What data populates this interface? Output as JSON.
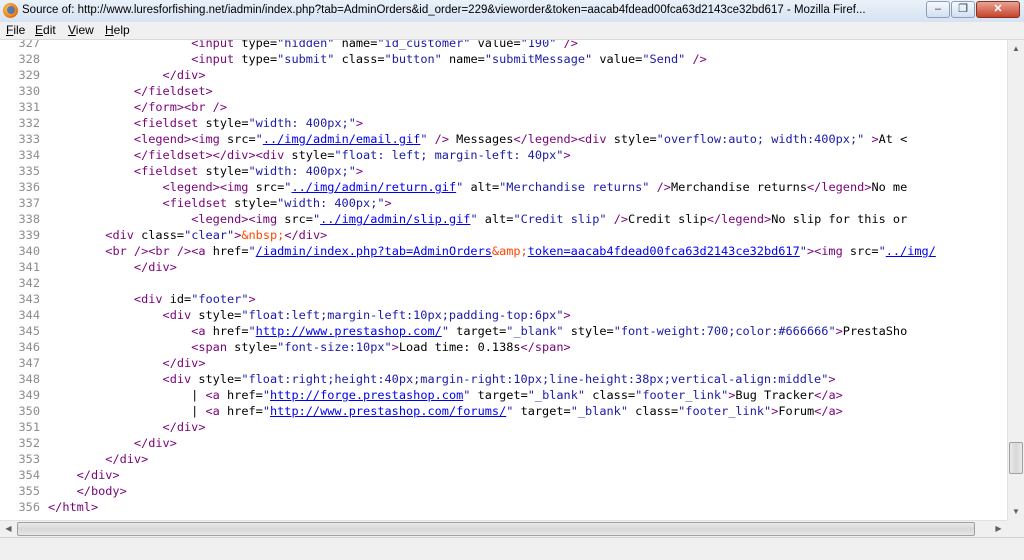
{
  "window": {
    "title": "Source of: http://www.luresforfishing.net/iadmin/index.php?tab=AdminOrders&id_order=229&vieworder&token=aacab4fdead00fca63d2143ce32bd617 - Mozilla Firef...",
    "minimize_glyph": "–",
    "maximize_glyph": "❐",
    "close_glyph": "✕"
  },
  "menu": [
    {
      "first": "F",
      "rest": "ile"
    },
    {
      "first": "E",
      "rest": "dit"
    },
    {
      "first": "V",
      "rest": "iew"
    },
    {
      "first": "H",
      "rest": "elp"
    }
  ],
  "source_lines": [
    {
      "n": "327",
      "parts": [
        [
          "t",
          "                    "
        ],
        [
          "g",
          "<input"
        ],
        [
          "t",
          " "
        ],
        [
          "a",
          "type"
        ],
        [
          "t",
          "="
        ],
        [
          "v",
          "\"hidden\""
        ],
        [
          "t",
          " "
        ],
        [
          "a",
          "name"
        ],
        [
          "t",
          "="
        ],
        [
          "v",
          "\"id_customer\""
        ],
        [
          "t",
          " "
        ],
        [
          "a",
          "value"
        ],
        [
          "t",
          "="
        ],
        [
          "v",
          "\"190\""
        ],
        [
          "t",
          " "
        ],
        [
          "g",
          "/>"
        ]
      ]
    },
    {
      "n": "328",
      "parts": [
        [
          "t",
          "                    "
        ],
        [
          "g",
          "<input"
        ],
        [
          "t",
          " "
        ],
        [
          "a",
          "type"
        ],
        [
          "t",
          "="
        ],
        [
          "v",
          "\"submit\""
        ],
        [
          "t",
          " "
        ],
        [
          "a",
          "class"
        ],
        [
          "t",
          "="
        ],
        [
          "v",
          "\"button\""
        ],
        [
          "t",
          " "
        ],
        [
          "a",
          "name"
        ],
        [
          "t",
          "="
        ],
        [
          "v",
          "\"submitMessage\""
        ],
        [
          "t",
          " "
        ],
        [
          "a",
          "value"
        ],
        [
          "t",
          "="
        ],
        [
          "v",
          "\"Send\""
        ],
        [
          "t",
          " "
        ],
        [
          "g",
          "/>"
        ]
      ]
    },
    {
      "n": "329",
      "parts": [
        [
          "t",
          "                "
        ],
        [
          "g",
          "</div>"
        ]
      ]
    },
    {
      "n": "330",
      "parts": [
        [
          "t",
          "            "
        ],
        [
          "g",
          "</fieldset>"
        ]
      ]
    },
    {
      "n": "331",
      "parts": [
        [
          "t",
          "            "
        ],
        [
          "g",
          "</form>"
        ],
        [
          "g",
          "<br />"
        ]
      ]
    },
    {
      "n": "332",
      "parts": [
        [
          "t",
          "            "
        ],
        [
          "g",
          "<fieldset"
        ],
        [
          "t",
          " "
        ],
        [
          "a",
          "style"
        ],
        [
          "t",
          "="
        ],
        [
          "v",
          "\"width: 400px;\""
        ],
        [
          "g",
          ">"
        ]
      ]
    },
    {
      "n": "333",
      "parts": [
        [
          "t",
          "            "
        ],
        [
          "g",
          "<legend>"
        ],
        [
          "g",
          "<img"
        ],
        [
          "t",
          " "
        ],
        [
          "a",
          "src"
        ],
        [
          "t",
          "="
        ],
        [
          "v",
          "\""
        ],
        [
          "l",
          "../img/admin/email.gif"
        ],
        [
          "v",
          "\""
        ],
        [
          "t",
          " "
        ],
        [
          "g",
          "/>"
        ],
        [
          "t",
          " Messages"
        ],
        [
          "g",
          "</legend>"
        ],
        [
          "g",
          "<div"
        ],
        [
          "t",
          " "
        ],
        [
          "a",
          "style"
        ],
        [
          "t",
          "="
        ],
        [
          "v",
          "\"overflow:auto; width:400px;\""
        ],
        [
          "t",
          " "
        ],
        [
          "g",
          ">"
        ],
        [
          "t",
          "At <"
        ]
      ]
    },
    {
      "n": "334",
      "parts": [
        [
          "t",
          "            "
        ],
        [
          "g",
          "</fieldset>"
        ],
        [
          "g",
          "</div>"
        ],
        [
          "g",
          "<div"
        ],
        [
          "t",
          " "
        ],
        [
          "a",
          "style"
        ],
        [
          "t",
          "="
        ],
        [
          "v",
          "\"float: left; margin-left: 40px\""
        ],
        [
          "g",
          ">"
        ]
      ]
    },
    {
      "n": "335",
      "parts": [
        [
          "t",
          "            "
        ],
        [
          "g",
          "<fieldset"
        ],
        [
          "t",
          " "
        ],
        [
          "a",
          "style"
        ],
        [
          "t",
          "="
        ],
        [
          "v",
          "\"width: 400px;\""
        ],
        [
          "g",
          ">"
        ]
      ]
    },
    {
      "n": "336",
      "parts": [
        [
          "t",
          "                "
        ],
        [
          "g",
          "<legend>"
        ],
        [
          "g",
          "<img"
        ],
        [
          "t",
          " "
        ],
        [
          "a",
          "src"
        ],
        [
          "t",
          "="
        ],
        [
          "v",
          "\""
        ],
        [
          "l",
          "../img/admin/return.gif"
        ],
        [
          "v",
          "\""
        ],
        [
          "t",
          " "
        ],
        [
          "a",
          "alt"
        ],
        [
          "t",
          "="
        ],
        [
          "v",
          "\"Merchandise returns\""
        ],
        [
          "t",
          " "
        ],
        [
          "g",
          "/>"
        ],
        [
          "t",
          "Merchandise returns"
        ],
        [
          "g",
          "</legend>"
        ],
        [
          "t",
          "No me"
        ]
      ]
    },
    {
      "n": "337",
      "parts": [
        [
          "t",
          "                "
        ],
        [
          "g",
          "<fieldset"
        ],
        [
          "t",
          " "
        ],
        [
          "a",
          "style"
        ],
        [
          "t",
          "="
        ],
        [
          "v",
          "\"width: 400px;\""
        ],
        [
          "g",
          ">"
        ]
      ]
    },
    {
      "n": "338",
      "parts": [
        [
          "t",
          "                    "
        ],
        [
          "g",
          "<legend>"
        ],
        [
          "g",
          "<img"
        ],
        [
          "t",
          " "
        ],
        [
          "a",
          "src"
        ],
        [
          "t",
          "="
        ],
        [
          "v",
          "\""
        ],
        [
          "l",
          "../img/admin/slip.gif"
        ],
        [
          "v",
          "\""
        ],
        [
          "t",
          " "
        ],
        [
          "a",
          "alt"
        ],
        [
          "t",
          "="
        ],
        [
          "v",
          "\"Credit slip\""
        ],
        [
          "t",
          " "
        ],
        [
          "g",
          "/>"
        ],
        [
          "t",
          "Credit slip"
        ],
        [
          "g",
          "</legend>"
        ],
        [
          "t",
          "No slip for this or"
        ]
      ]
    },
    {
      "n": "339",
      "parts": [
        [
          "t",
          "        "
        ],
        [
          "g",
          "<div"
        ],
        [
          "t",
          " "
        ],
        [
          "a",
          "class"
        ],
        [
          "t",
          "="
        ],
        [
          "v",
          "\"clear\""
        ],
        [
          "g",
          ">"
        ],
        [
          "e",
          "&nbsp;"
        ],
        [
          "g",
          "</div>"
        ]
      ]
    },
    {
      "n": "340",
      "parts": [
        [
          "t",
          "        "
        ],
        [
          "g",
          "<br />"
        ],
        [
          "g",
          "<br />"
        ],
        [
          "g",
          "<a"
        ],
        [
          "t",
          " "
        ],
        [
          "a",
          "href"
        ],
        [
          "t",
          "="
        ],
        [
          "v",
          "\""
        ],
        [
          "l",
          "/iadmin/index.php?tab=AdminOrders"
        ],
        [
          "e",
          "&amp;"
        ],
        [
          "l",
          "token=aacab4fdead00fca63d2143ce32bd617"
        ],
        [
          "v",
          "\""
        ],
        [
          "g",
          ">"
        ],
        [
          "g",
          "<img"
        ],
        [
          "t",
          " "
        ],
        [
          "a",
          "src"
        ],
        [
          "t",
          "="
        ],
        [
          "v",
          "\""
        ],
        [
          "l",
          "../img/"
        ]
      ]
    },
    {
      "n": "341",
      "parts": [
        [
          "t",
          "            "
        ],
        [
          "g",
          "</div>"
        ]
      ]
    },
    {
      "n": "342",
      "parts": []
    },
    {
      "n": "343",
      "parts": [
        [
          "t",
          "            "
        ],
        [
          "g",
          "<div"
        ],
        [
          "t",
          " "
        ],
        [
          "a",
          "id"
        ],
        [
          "t",
          "="
        ],
        [
          "v",
          "\"footer\""
        ],
        [
          "g",
          ">"
        ]
      ]
    },
    {
      "n": "344",
      "parts": [
        [
          "t",
          "                "
        ],
        [
          "g",
          "<div"
        ],
        [
          "t",
          " "
        ],
        [
          "a",
          "style"
        ],
        [
          "t",
          "="
        ],
        [
          "v",
          "\"float:left;margin-left:10px;padding-top:6px\""
        ],
        [
          "g",
          ">"
        ]
      ]
    },
    {
      "n": "345",
      "parts": [
        [
          "t",
          "                    "
        ],
        [
          "g",
          "<a"
        ],
        [
          "t",
          " "
        ],
        [
          "a",
          "href"
        ],
        [
          "t",
          "="
        ],
        [
          "v",
          "\""
        ],
        [
          "l",
          "http://www.prestashop.com/"
        ],
        [
          "v",
          "\""
        ],
        [
          "t",
          " "
        ],
        [
          "a",
          "target"
        ],
        [
          "t",
          "="
        ],
        [
          "v",
          "\"_blank\""
        ],
        [
          "t",
          " "
        ],
        [
          "a",
          "style"
        ],
        [
          "t",
          "="
        ],
        [
          "v",
          "\"font-weight:700;color:#666666\""
        ],
        [
          "g",
          ">"
        ],
        [
          "t",
          "PrestaSho"
        ]
      ]
    },
    {
      "n": "346",
      "parts": [
        [
          "t",
          "                    "
        ],
        [
          "g",
          "<span"
        ],
        [
          "t",
          " "
        ],
        [
          "a",
          "style"
        ],
        [
          "t",
          "="
        ],
        [
          "v",
          "\"font-size:10px\""
        ],
        [
          "g",
          ">"
        ],
        [
          "t",
          "Load time: 0.138s"
        ],
        [
          "g",
          "</span>"
        ]
      ]
    },
    {
      "n": "347",
      "parts": [
        [
          "t",
          "                "
        ],
        [
          "g",
          "</div>"
        ]
      ]
    },
    {
      "n": "348",
      "parts": [
        [
          "t",
          "                "
        ],
        [
          "g",
          "<div"
        ],
        [
          "t",
          " "
        ],
        [
          "a",
          "style"
        ],
        [
          "t",
          "="
        ],
        [
          "v",
          "\"float:right;height:40px;margin-right:10px;line-height:38px;vertical-align:middle\""
        ],
        [
          "g",
          ">"
        ]
      ]
    },
    {
      "n": "349",
      "parts": [
        [
          "t",
          "                    | "
        ],
        [
          "g",
          "<a"
        ],
        [
          "t",
          " "
        ],
        [
          "a",
          "href"
        ],
        [
          "t",
          "="
        ],
        [
          "v",
          "\""
        ],
        [
          "l",
          "http://forge.prestashop.com"
        ],
        [
          "v",
          "\""
        ],
        [
          "t",
          " "
        ],
        [
          "a",
          "target"
        ],
        [
          "t",
          "="
        ],
        [
          "v",
          "\"_blank\""
        ],
        [
          "t",
          " "
        ],
        [
          "a",
          "class"
        ],
        [
          "t",
          "="
        ],
        [
          "v",
          "\"footer_link\""
        ],
        [
          "g",
          ">"
        ],
        [
          "t",
          "Bug Tracker"
        ],
        [
          "g",
          "</a>"
        ]
      ]
    },
    {
      "n": "350",
      "parts": [
        [
          "t",
          "                    | "
        ],
        [
          "g",
          "<a"
        ],
        [
          "t",
          " "
        ],
        [
          "a",
          "href"
        ],
        [
          "t",
          "="
        ],
        [
          "v",
          "\""
        ],
        [
          "l",
          "http://www.prestashop.com/forums/"
        ],
        [
          "v",
          "\""
        ],
        [
          "t",
          " "
        ],
        [
          "a",
          "target"
        ],
        [
          "t",
          "="
        ],
        [
          "v",
          "\"_blank\""
        ],
        [
          "t",
          " "
        ],
        [
          "a",
          "class"
        ],
        [
          "t",
          "="
        ],
        [
          "v",
          "\"footer_link\""
        ],
        [
          "g",
          ">"
        ],
        [
          "t",
          "Forum"
        ],
        [
          "g",
          "</a>"
        ]
      ]
    },
    {
      "n": "351",
      "parts": [
        [
          "t",
          "                "
        ],
        [
          "g",
          "</div>"
        ]
      ]
    },
    {
      "n": "352",
      "parts": [
        [
          "t",
          "            "
        ],
        [
          "g",
          "</div>"
        ]
      ]
    },
    {
      "n": "353",
      "parts": [
        [
          "t",
          "        "
        ],
        [
          "g",
          "</div>"
        ]
      ]
    },
    {
      "n": "354",
      "parts": [
        [
          "t",
          "    "
        ],
        [
          "g",
          "</div>"
        ]
      ]
    },
    {
      "n": "355",
      "parts": [
        [
          "t",
          "    "
        ],
        [
          "g",
          "</body>"
        ]
      ]
    },
    {
      "n": "356",
      "parts": [
        [
          "g",
          "</html>"
        ]
      ]
    }
  ],
  "scrollbars": {
    "vertical_position": 0.93,
    "horizontal_position": 0.0,
    "horizontal_visible_fraction": 0.985,
    "up_glyph": "▲",
    "down_glyph": "▼",
    "left_glyph": "◀",
    "right_glyph": "▶"
  }
}
